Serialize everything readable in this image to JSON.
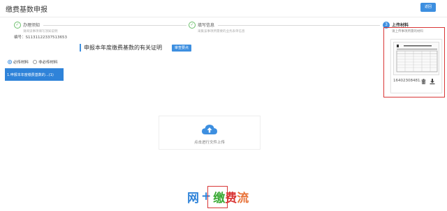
{
  "header": {
    "title": "缴费基数申报",
    "back_label": "返回"
  },
  "steps": [
    {
      "title": "办理须知",
      "desc": "请阅读事项填写须知说明",
      "state": "done"
    },
    {
      "title": "填写信息",
      "desc": "采集该事项所需要的业务表单信息",
      "state": "done"
    },
    {
      "number": "3",
      "title": "上传材料",
      "desc": "请上传事项所需的材料",
      "state": "active"
    }
  ],
  "application": {
    "number_label": "编号：S1131122337513653"
  },
  "section": {
    "title": "申报本年度缴费基数的有关证明",
    "review_label": "审查要点"
  },
  "filters": {
    "required_label": "必传材料",
    "optional_label": "非必传材料",
    "selected": "required"
  },
  "materials": [
    {
      "label": "1.申报本年度缴费基数的…(1)"
    }
  ],
  "upload": {
    "label": "点击进行文件上传"
  },
  "file": {
    "name": "16402308481…"
  },
  "watermark": {
    "chars": [
      "网",
      "+",
      "缴",
      "费",
      "流"
    ],
    "colors": [
      "#2f83d9",
      "#2f83d9",
      "#3aaa35",
      "#d93636",
      "#e8743b"
    ]
  },
  "colors": {
    "accent": "#3d8fe0",
    "done": "#6cbf6c",
    "highlight": "#d93636"
  }
}
